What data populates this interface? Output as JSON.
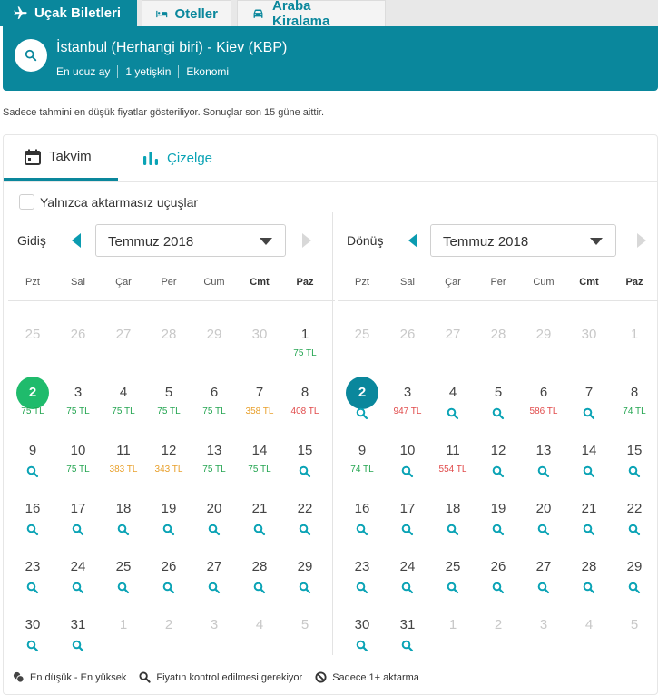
{
  "top_tabs": [
    {
      "label": "Uçak Biletleri",
      "icon": "plane-icon"
    },
    {
      "label": "Oteller",
      "icon": "bed-icon"
    },
    {
      "label": "Araba Kiralama",
      "icon": "car-icon"
    }
  ],
  "search": {
    "route": "İstanbul (Herhangi biri) - Kiev (KBP)",
    "meta": [
      "En ucuz ay",
      "1 yetişkin",
      "Ekonomi"
    ]
  },
  "notice": "Sadece tahmini en düşük fiyatlar gösteriliyor. Sonuçlar son 15 güne aittir.",
  "view_tabs": [
    "Takvim",
    "Çizelge"
  ],
  "nonstop_label": "Yalnızca aktarmasız uçuşlar",
  "weekdays": [
    "Pzt",
    "Sal",
    "Çar",
    "Per",
    "Cum",
    "Cmt",
    "Paz"
  ],
  "outbound": {
    "label": "Gidiş",
    "month": "Temmuz 2018",
    "weeks": [
      [
        {
          "d": "25",
          "m": 1
        },
        {
          "d": "26",
          "m": 1
        },
        {
          "d": "27",
          "m": 1
        },
        {
          "d": "28",
          "m": 1
        },
        {
          "d": "29",
          "m": 1
        },
        {
          "d": "30",
          "m": 1
        },
        {
          "d": "1",
          "p": "75 TL",
          "c": "green"
        }
      ],
      [
        {
          "d": "2",
          "p": "75 TL",
          "c": "green",
          "sel": 1
        },
        {
          "d": "3",
          "p": "75 TL",
          "c": "green"
        },
        {
          "d": "4",
          "p": "75 TL",
          "c": "green"
        },
        {
          "d": "5",
          "p": "75 TL",
          "c": "green"
        },
        {
          "d": "6",
          "p": "75 TL",
          "c": "green"
        },
        {
          "d": "7",
          "p": "358 TL",
          "c": "orange"
        },
        {
          "d": "8",
          "p": "408 TL",
          "c": "red"
        }
      ],
      [
        {
          "d": "9",
          "q": 1
        },
        {
          "d": "10",
          "p": "75 TL",
          "c": "green"
        },
        {
          "d": "11",
          "p": "383 TL",
          "c": "orange"
        },
        {
          "d": "12",
          "p": "343 TL",
          "c": "orange"
        },
        {
          "d": "13",
          "p": "75 TL",
          "c": "green"
        },
        {
          "d": "14",
          "p": "75 TL",
          "c": "green"
        },
        {
          "d": "15",
          "q": 1
        }
      ],
      [
        {
          "d": "16",
          "q": 1
        },
        {
          "d": "17",
          "q": 1
        },
        {
          "d": "18",
          "q": 1
        },
        {
          "d": "19",
          "q": 1
        },
        {
          "d": "20",
          "q": 1
        },
        {
          "d": "21",
          "q": 1
        },
        {
          "d": "22",
          "q": 1
        }
      ],
      [
        {
          "d": "23",
          "q": 1
        },
        {
          "d": "24",
          "q": 1
        },
        {
          "d": "25",
          "q": 1
        },
        {
          "d": "26",
          "q": 1
        },
        {
          "d": "27",
          "q": 1
        },
        {
          "d": "28",
          "q": 1
        },
        {
          "d": "29",
          "q": 1
        }
      ],
      [
        {
          "d": "30",
          "q": 1
        },
        {
          "d": "31",
          "q": 1
        },
        {
          "d": "1",
          "m": 1
        },
        {
          "d": "2",
          "m": 1
        },
        {
          "d": "3",
          "m": 1
        },
        {
          "d": "4",
          "m": 1
        },
        {
          "d": "5",
          "m": 1
        }
      ]
    ]
  },
  "return": {
    "label": "Dönüş",
    "month": "Temmuz 2018",
    "weeks": [
      [
        {
          "d": "25",
          "m": 1
        },
        {
          "d": "26",
          "m": 1
        },
        {
          "d": "27",
          "m": 1
        },
        {
          "d": "28",
          "m": 1
        },
        {
          "d": "29",
          "m": 1
        },
        {
          "d": "30",
          "m": 1
        },
        {
          "d": "1",
          "m": 1
        }
      ],
      [
        {
          "d": "2",
          "q": 1,
          "sel": 1
        },
        {
          "d": "3",
          "p": "947 TL",
          "c": "red"
        },
        {
          "d": "4",
          "q": 1
        },
        {
          "d": "5",
          "q": 1
        },
        {
          "d": "6",
          "p": "586 TL",
          "c": "red"
        },
        {
          "d": "7",
          "q": 1
        },
        {
          "d": "8",
          "p": "74 TL",
          "c": "green"
        }
      ],
      [
        {
          "d": "9",
          "p": "74 TL",
          "c": "green"
        },
        {
          "d": "10",
          "q": 1
        },
        {
          "d": "11",
          "p": "554 TL",
          "c": "red"
        },
        {
          "d": "12",
          "q": 1
        },
        {
          "d": "13",
          "q": 1
        },
        {
          "d": "14",
          "q": 1
        },
        {
          "d": "15",
          "q": 1
        }
      ],
      [
        {
          "d": "16",
          "q": 1
        },
        {
          "d": "17",
          "q": 1
        },
        {
          "d": "18",
          "q": 1
        },
        {
          "d": "19",
          "q": 1
        },
        {
          "d": "20",
          "q": 1
        },
        {
          "d": "21",
          "q": 1
        },
        {
          "d": "22",
          "q": 1
        }
      ],
      [
        {
          "d": "23",
          "q": 1
        },
        {
          "d": "24",
          "q": 1
        },
        {
          "d": "25",
          "q": 1
        },
        {
          "d": "26",
          "q": 1
        },
        {
          "d": "27",
          "q": 1
        },
        {
          "d": "28",
          "q": 1
        },
        {
          "d": "29",
          "q": 1
        }
      ],
      [
        {
          "d": "30",
          "q": 1
        },
        {
          "d": "31",
          "q": 1
        },
        {
          "d": "1",
          "m": 1
        },
        {
          "d": "2",
          "m": 1
        },
        {
          "d": "3",
          "m": 1
        },
        {
          "d": "4",
          "m": 1
        },
        {
          "d": "5",
          "m": 1
        }
      ]
    ]
  },
  "legend": [
    {
      "label": "En düşük - En yüksek",
      "icon": "coins-icon"
    },
    {
      "label": "Fiyatın kontrol edilmesi gerekiyor",
      "icon": "search-icon"
    },
    {
      "label": "Sadece 1+ aktarma",
      "icon": "ban-icon"
    }
  ],
  "colors": {
    "accent": "#0a879c",
    "selected_outbound": "#1fbb6c",
    "price_low": "#24a551",
    "price_mid": "#e8a02c",
    "price_high": "#e14b4b"
  }
}
